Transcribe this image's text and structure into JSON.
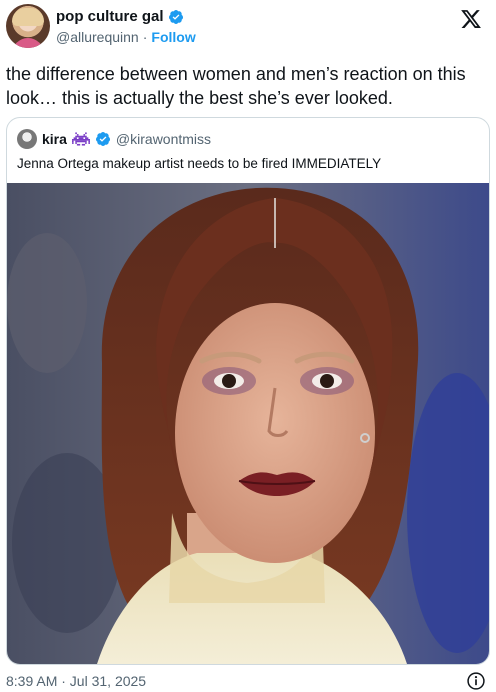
{
  "author": {
    "display_name": "pop culture gal",
    "handle": "@allurequinn",
    "separator": "·",
    "follow_label": "Follow"
  },
  "tweet": {
    "text": "the difference between women and men’s reaction on this look… this is actually the best she’s ever looked."
  },
  "quote": {
    "display_name": "kira",
    "handle": "@kirawontmiss",
    "text": "Jenna Ortega makeup artist needs to be fired IMMEDIATELY"
  },
  "footer": {
    "timestamp": "8:39 AM · Jul 31, 2025"
  },
  "icons": {
    "verified": "verified-badge-icon",
    "brand": "x-logo-icon",
    "emoji": "alien-monster-emoji-icon",
    "info": "info-icon"
  },
  "colors": {
    "accent": "#1d9bf0",
    "secondary_text": "#536471",
    "border": "#cfd9de",
    "quote_emoji": "#7b3fc7"
  }
}
